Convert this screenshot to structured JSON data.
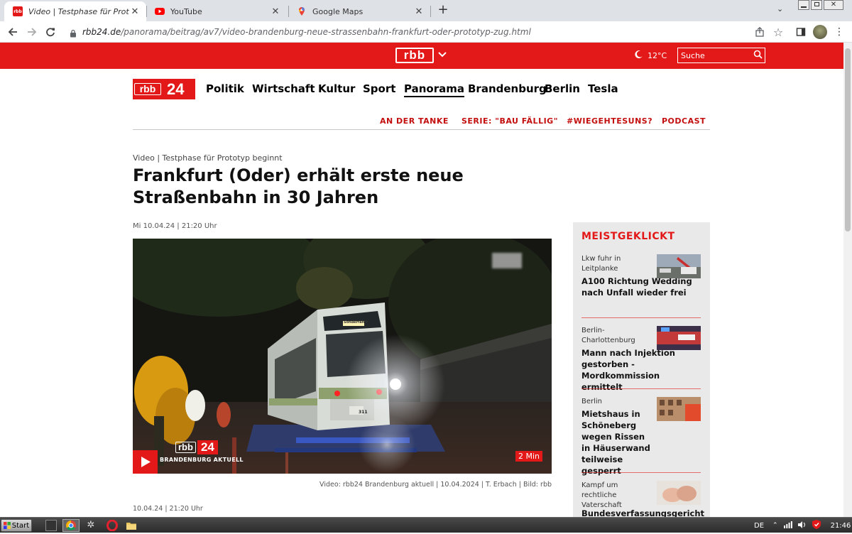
{
  "browser": {
    "tabs": [
      {
        "title": "Video | Testphase für Prototyp beginnt",
        "favicon": "rbb-icon",
        "active": true
      },
      {
        "title": "YouTube",
        "favicon": "youtube-icon",
        "active": false
      },
      {
        "title": "Google Maps",
        "favicon": "google-maps-icon",
        "active": false
      }
    ],
    "new_tab": "+",
    "url_host": "rbb24.de",
    "url_path": "/panorama/beitrag/av7/video-brandenburg-neue-strassenbahn-frankfurt-oder-prototyp-zug.html"
  },
  "topbar": {
    "logo": "rbb",
    "temperature": "12°C",
    "search_placeholder": "Suche"
  },
  "nav": {
    "logo_left": "rbb",
    "logo_right": "24",
    "items": [
      "Politik",
      "Wirtschaft",
      "Kultur",
      "Sport",
      "Panorama",
      "Brandenburg",
      "Berlin",
      "Tesla"
    ],
    "active": "Panorama",
    "subnav": [
      "AN DER TANKE",
      "SERIE: \"BAU FÄLLIG\"",
      "#WIEGEHTESUNS?",
      "PODCAST"
    ]
  },
  "article": {
    "kicker": "Video | Testphase für Prototyp beginnt",
    "headline": "Frankfurt (Oder) erhält erste neue Straßenbahn in 30 Jahren",
    "date": "Mi 10.04.24 | 21:20 Uhr",
    "video": {
      "logo_left": "rbb",
      "logo_right": "24",
      "show": "BRANDENBURG AKTUELL",
      "duration": "2 Min",
      "tram_sign": "Sonderfahrt",
      "tram_number": "311"
    },
    "caption": "Video: rbb24 Brandenburg aktuell | 10.04.2024 | T. Erbach | Bild: rbb",
    "date_bottom": "10.04.24 | 21:20 Uhr"
  },
  "sidebar": {
    "title": "MEISTGEKLICKT",
    "items": [
      {
        "kicker": "Lkw fuhr in Leitplanke",
        "headline": "A100 Richtung Wedding nach Unfall wieder frei"
      },
      {
        "kicker": "Berlin-Charlottenburg",
        "headline": "Mann nach Injektion gestorben - Mordkommission ermittelt"
      },
      {
        "kicker": "Berlin",
        "headline": "Mietshaus in Schöneberg wegen Rissen in Häuserwand teilweise gesperrt"
      },
      {
        "kicker": "Kampf um rechtliche Vaterschaft",
        "headline": "Bundesverfassungsgericht"
      }
    ]
  },
  "taskbar": {
    "start": "Start",
    "language": "DE",
    "time": "21:46"
  },
  "colors": {
    "rbb_red": "#e31818",
    "subnav_red": "#c40f0f",
    "sidebar_bg": "#e9e9e9"
  }
}
